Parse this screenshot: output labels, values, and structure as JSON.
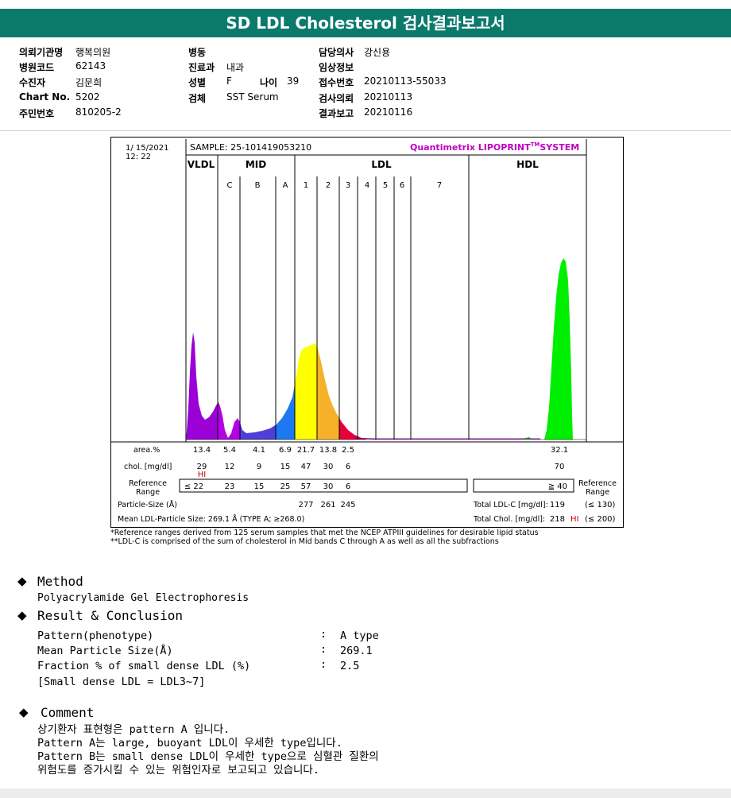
{
  "title": "SD LDL Cholesterol 검사결과보고서",
  "info": {
    "hospital_label": "의뢰기관명",
    "hospital": "행복의원",
    "code_label": "병원코드",
    "code": "62143",
    "patient_label": "수진자",
    "patient": "김문희",
    "chart_label": "Chart No.",
    "chart": "5202",
    "resident_label": "주민번호",
    "resident": "810205-2",
    "ward_label": "병동",
    "ward": "",
    "dept_label": "진료과",
    "dept": "내과",
    "sex_label": "성별",
    "sex": "F",
    "age_label": "나이",
    "age": "39",
    "specimen_label": "검체",
    "specimen": "SST Serum",
    "doctor_label": "담당의사",
    "doctor": "강신용",
    "clinical_label": "임상정보",
    "clinical": "",
    "receipt_label": "접수번호",
    "receipt": "20210113-55033",
    "request_label": "검사의뢰",
    "request": "20210113",
    "result_label": "결과보고",
    "result": "20210116"
  },
  "report": {
    "date": "1/ 15/2021",
    "time": "12: 22",
    "sample": "SAMPLE:  25-101419053210",
    "brand_main": "Quantimetrix LIPOPRINT",
    "brand_tm": "TM",
    "brand_system": "SYSTEM",
    "brand_color": "#c000c0",
    "groups": [
      "VLDL",
      "MID",
      "LDL",
      "HDL"
    ],
    "band_labels": [
      "C",
      "B",
      "A",
      "1",
      "2",
      "3",
      "4",
      "5",
      "6",
      "7"
    ],
    "area_label": "area.%",
    "area_values": [
      "13.4",
      "5.4",
      "4.1",
      "6.9",
      "21.7",
      "13.8",
      "2.5",
      "32.1"
    ],
    "chol_label": "chol. [mg/dl]",
    "chol_values": [
      "29",
      "12",
      "9",
      "15",
      "47",
      "30",
      "6",
      "70"
    ],
    "chol_flag": "HI",
    "ref_label_1": "Reference",
    "ref_label_2": "Range",
    "ref_values": [
      "≤  22",
      "23",
      "15",
      "25",
      "57",
      "30",
      "6"
    ],
    "hdl_ref": "≧ 40",
    "particle_label": "Particle-Size (Å)",
    "particle_values": [
      "277",
      "261",
      "245"
    ],
    "mean_label": "Mean LDL-Particle Size:   269.1 Å   (TYPE A; ≥268.0)",
    "total_ldl_label": "Total LDL-C [mg/dl]:",
    "total_ldl_value": "119",
    "total_ldl_ref": "(≤ 130)",
    "total_chol_label": "Total Chol. [mg/dl]:",
    "total_chol_value": "218",
    "total_chol_flag": "HI",
    "total_chol_ref": "(≤ 200)",
    "flag_color": "#cc0000",
    "colors": {
      "vldl": "#9b00d6",
      "midc": "#b400e6",
      "midb": "#4f3fd8",
      "mida": "#1e78f0",
      "ldl1": "#ffff00",
      "ldl2": "#f7b02a",
      "ldl3": "#e8003a",
      "hdl": "#00ee00"
    }
  },
  "footnotes": [
    "*Reference ranges derived from 125 serum samples that met the NCEP ATPIII guidelines for desirable lipid status",
    "**LDL-C is comprised of the sum of cholesterol in Mid bands C through A as well as all the subfractions"
  ],
  "method": {
    "heading": "Method",
    "text": "Polyacrylamide Gel Electrophoresis"
  },
  "result_section": {
    "heading": "Result & Conclusion",
    "rows": [
      {
        "label": "Pattern(phenotype)",
        "sep": ":",
        "value": "A type"
      },
      {
        "label": "Mean Particle Size(Å)",
        "sep": ":",
        "value": "269.1"
      },
      {
        "label": "Fraction % of small dense LDL (%)",
        "sep": ":",
        "value": "2.5"
      }
    ],
    "note": "[Small dense LDL = LDL3~7]"
  },
  "comment": {
    "heading": "Comment",
    "lines": [
      "상기환자 표현형은 pattern A 입니다.",
      "Pattern A는 large, buoyant LDL이 우세한 type입니다.",
      "Pattern B는 small dense LDL이 우세한 type으로 심혈관 질환의",
      "위험도를 증가시킬 수 있는 위험인자로 보고되고 있습니다."
    ]
  },
  "icons": {
    "bullet": "diamond-icon"
  }
}
